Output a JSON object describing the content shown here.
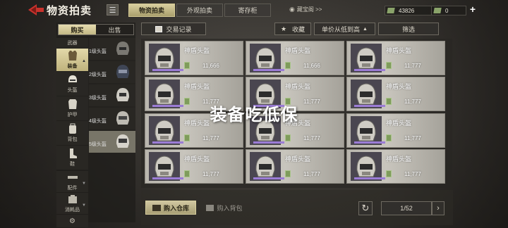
{
  "app": {
    "title": "物资拍卖",
    "menu_icon": "hamburger-icon",
    "back_icon": "back-arrow-icon"
  },
  "tabs": [
    {
      "label": "物资拍卖",
      "active": true
    },
    {
      "label": "外观拍卖",
      "active": false
    },
    {
      "label": "寄存柜",
      "active": false
    }
  ],
  "treasure_link": {
    "label": "藏宝阁 >>",
    "icon": "eye-icon"
  },
  "currency": [
    {
      "icon": "cash-icon",
      "value": "43826"
    },
    {
      "icon": "cash-icon",
      "value": "0"
    }
  ],
  "plus_label": "+",
  "buysell": {
    "buy": "购买",
    "sell": "出售"
  },
  "categories": [
    {
      "label": "武器",
      "icon": "gun-icon",
      "active": false
    },
    {
      "label": "装备",
      "icon": "vest-icon",
      "active": true
    },
    {
      "label": "头盔",
      "icon": "helmet-icon",
      "active": false
    },
    {
      "label": "护甲",
      "icon": "armor-icon",
      "active": false
    },
    {
      "label": "背包",
      "icon": "backpack-icon",
      "active": false
    },
    {
      "label": "鞋",
      "icon": "boot-icon",
      "active": false
    },
    {
      "label": "配件",
      "icon": "attachment-icon",
      "active": false
    },
    {
      "label": "消耗品",
      "icon": "consumable-icon",
      "active": false
    },
    {
      "label": "",
      "icon": "gear-icon",
      "active": false
    }
  ],
  "levels": [
    {
      "label": "1级头盔",
      "active": false
    },
    {
      "label": "2级头盔",
      "active": false
    },
    {
      "label": "3级头盔",
      "active": false
    },
    {
      "label": "4级头盔",
      "active": false
    },
    {
      "label": "5级头盔",
      "active": true
    }
  ],
  "toolbar": {
    "records": "交易记录",
    "favorite": "收藏",
    "sort": "单价从低到高",
    "filter": "筛选"
  },
  "items": [
    {
      "name": "神盾头盔",
      "price": "11,666"
    },
    {
      "name": "神盾头盔",
      "price": "11,666"
    },
    {
      "name": "神盾头盔",
      "price": "11,777"
    },
    {
      "name": "神盾头盔",
      "price": "11,777"
    },
    {
      "name": "神盾头盔",
      "price": "11,777"
    },
    {
      "name": "神盾头盔",
      "price": "11,777"
    },
    {
      "name": "神盾头盔",
      "price": "11,777"
    },
    {
      "name": "神盾头盔",
      "price": "11,777"
    },
    {
      "name": "神盾头盔",
      "price": "11,777"
    },
    {
      "name": "神盾头盔",
      "price": "11,777"
    },
    {
      "name": "神盾头盔",
      "price": "11,777"
    },
    {
      "name": "神盾头盔",
      "price": "11,777"
    }
  ],
  "bottom": {
    "buy_warehouse": "购入仓库",
    "buy_backpack": "购入背包",
    "page": "1/52",
    "refresh_icon": "refresh-icon",
    "next_icon": "chevron-right-icon"
  },
  "overlay_text": "装备吃低保",
  "colors": {
    "accent_gold": "#cfc6a0",
    "rarity_purple": "#9b7cd6",
    "cash_green": "#7f9c5c",
    "back_red": "#c8322c"
  }
}
